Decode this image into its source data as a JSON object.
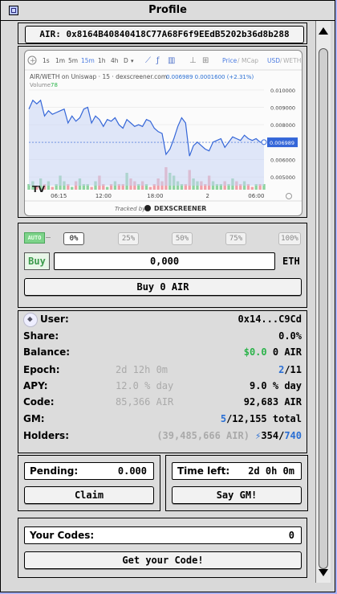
{
  "window": {
    "title": "Profile"
  },
  "address_bar": {
    "text": "AIR: 0x8164B40840418C77A68F6f9EEdB5202b36d8b288"
  },
  "chart": {
    "timeframes": [
      "1s",
      "1m",
      "5m",
      "15m",
      "1h",
      "4h",
      "D"
    ],
    "active_timeframe": "15m",
    "toolbar_right": [
      "Price",
      "/",
      "MCap",
      "USD",
      "/",
      "WETH"
    ],
    "pair_label": "AIR/WETH on Uniswap · 15 · dexscreener.com",
    "ohlc_text": "0.006989  0.0001600 (+2.31%)",
    "volume_label": "Volume",
    "volume_value": "78",
    "y_ticks": [
      "0.010000",
      "0.009000",
      "0.008000",
      "0.007000",
      "0.006000",
      "0.005000"
    ],
    "current_price": "0.006989",
    "x_ticks": [
      "06:15",
      "12:00",
      "18:00",
      "2",
      "06:00"
    ],
    "tracked_by": "Tracked by",
    "brand": "DEXSCREENER",
    "chart_data": {
      "type": "line",
      "ylim": [
        0.0045,
        0.0105
      ],
      "values": [
        0.0089,
        0.0094,
        0.0092,
        0.0094,
        0.0085,
        0.0088,
        0.0086,
        0.0087,
        0.0088,
        0.0089,
        0.0081,
        0.0085,
        0.0082,
        0.0084,
        0.0089,
        0.009,
        0.0081,
        0.0085,
        0.0083,
        0.0079,
        0.0083,
        0.0082,
        0.0084,
        0.008,
        0.0078,
        0.0083,
        0.0081,
        0.0079,
        0.008,
        0.0079,
        0.0083,
        0.0082,
        0.0078,
        0.0076,
        0.0075,
        0.0063,
        0.0066,
        0.0072,
        0.0079,
        0.0084,
        0.0081,
        0.0062,
        0.0068,
        0.007,
        0.0068,
        0.0066,
        0.0065,
        0.007,
        0.0071,
        0.0072,
        0.0067,
        0.007,
        0.0073,
        0.0072,
        0.0071,
        0.0074,
        0.0072,
        0.0071,
        0.0072,
        0.007,
        0.007
      ],
      "volume": [
        2,
        3,
        1,
        4,
        2,
        3,
        1,
        2,
        5,
        3,
        2,
        1,
        3,
        4,
        2,
        2,
        1,
        3,
        5,
        2,
        1,
        2,
        3,
        2,
        2,
        6,
        4,
        3,
        2,
        3,
        2,
        1,
        2,
        4,
        3,
        8,
        6,
        5,
        3,
        2,
        2,
        7,
        4,
        3,
        3,
        2,
        5,
        3,
        2,
        2,
        3,
        2,
        4,
        3,
        2,
        3,
        2,
        1,
        2,
        2,
        2
      ]
    }
  },
  "trade": {
    "auto_label": "AUTO",
    "percents": [
      "0%",
      "25%",
      "50%",
      "75%",
      "100%"
    ],
    "buy_label": "Buy",
    "amount": "0,000",
    "unit": "ETH",
    "buy_button": "Buy 0 AIR"
  },
  "stats": {
    "user_label": "User:",
    "user_value": "0x14...C9Cd",
    "share_label": "Share:",
    "share_value": "0.0%",
    "balance_label": "Balance:",
    "balance_usd": "$0.0",
    "balance_air": "0 AIR",
    "epoch_label": "Epoch:",
    "epoch_mid": "2d 12h 0m",
    "epoch_current": "2",
    "epoch_total": "/11",
    "apy_label": "APY:",
    "apy_mid": "12.0 % day",
    "apy_value": "9.0 % day",
    "code_label": "Code:",
    "code_mid": "85,366 AIR",
    "code_value": "92,683 AIR",
    "gm_label": "GM:",
    "gm_current": "5",
    "gm_total": "/12,155 total",
    "holders_label": "Holders:",
    "holders_mid": "(39,485,666 AIR)",
    "holders_a": "354",
    "holders_sep": "/",
    "holders_b": "740"
  },
  "claim": {
    "pending_label": "Pending:",
    "pending_value": "0.000",
    "claim_button": "Claim"
  },
  "gm": {
    "time_label": "Time left:",
    "time_value": "2d 0h 0m",
    "gm_button": "Say GM!"
  },
  "codes": {
    "label": "Your Codes:",
    "value": "0",
    "button": "Get your Code!"
  },
  "colors": {
    "accent_blue": "#2a6fd4",
    "green": "#2bb34a",
    "desktop": "#a9b2f5"
  }
}
